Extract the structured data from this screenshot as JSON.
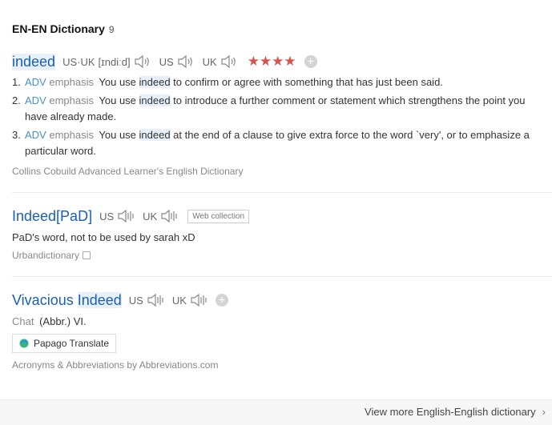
{
  "header": {
    "title": "EN-EN Dictionary",
    "count": "9"
  },
  "entry1": {
    "headword": "indeed",
    "pron_uk_us_label": "US·UK",
    "pron_ipa": "[ɪndiːd]",
    "us_label": "US",
    "uk_label": "UK",
    "stars": "★★★★",
    "senses": [
      {
        "num": "1.",
        "pos": "ADV",
        "gram": "emphasis",
        "pre": "You use ",
        "hw": "indeed",
        "post": " to confirm or agree with something that has just been said."
      },
      {
        "num": "2.",
        "pos": "ADV",
        "gram": "emphasis",
        "pre": "You use ",
        "hw": "indeed",
        "post": " to introduce a further comment or statement which strengthens the point you have already made."
      },
      {
        "num": "3.",
        "pos": "ADV",
        "gram": "emphasis",
        "pre": "You use ",
        "hw": "indeed",
        "post": " at the end of a clause to give extra force to the word `very', or to emphasize a particular word."
      }
    ],
    "source": "Collins Cobuild Advanced Learner's English Dictionary"
  },
  "entry2": {
    "headword": "Indeed[PaD]",
    "us_label": "US",
    "uk_label": "UK",
    "tag": "Web collection",
    "definition": "PaD's word, not to be used by sarah xD",
    "source": "Urbandictionary"
  },
  "entry3": {
    "headword_a": "Vivacious ",
    "headword_b": "Indeed",
    "us_label": "US",
    "uk_label": "UK",
    "category": "Chat",
    "definition": "(Abbr.) VI.",
    "papago_label": "Papago Translate",
    "source": "Acronyms & Abbreviations by Abbreviations.com"
  },
  "footer": {
    "more_label": "View more English-English dictionary"
  },
  "colors": {
    "headword": "#1a5fb4",
    "pos": "#4a90c2",
    "stars": "#d9534f",
    "highlight": "#e8f1fb"
  },
  "icons": [
    "speaker-icon",
    "plus-icon",
    "copy-icon",
    "papago-icon",
    "chevron-right-icon"
  ]
}
